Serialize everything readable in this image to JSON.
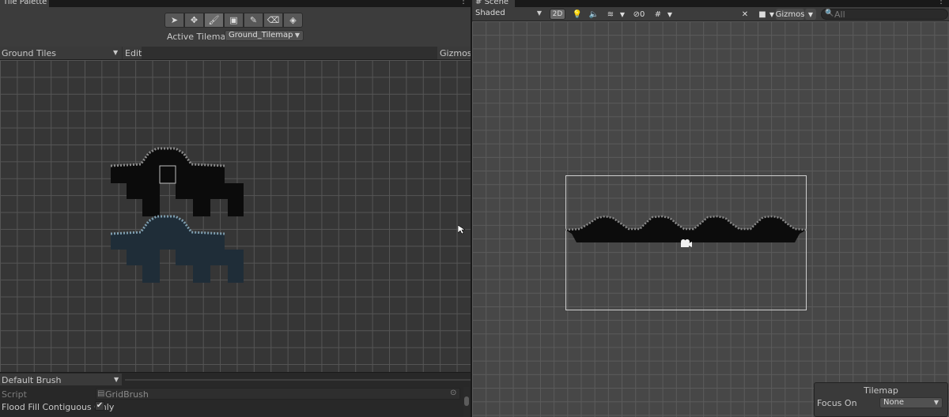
{
  "tile_palette": {
    "tab_title": "Tile Palette",
    "tools": [
      {
        "name": "select-icon",
        "glyph": "➤"
      },
      {
        "name": "move-icon",
        "glyph": "✥"
      },
      {
        "name": "paint-brush-icon",
        "glyph": "🖌"
      },
      {
        "name": "box-fill-icon",
        "glyph": "▣"
      },
      {
        "name": "picker-icon",
        "glyph": "✎"
      },
      {
        "name": "eraser-icon",
        "glyph": "⌫"
      },
      {
        "name": "fill-bucket-icon",
        "glyph": "◈"
      }
    ],
    "active_tilemap_label": "Active Tilemap",
    "active_tilemap_value": "Ground_Tilemap",
    "palette_dropdown": "Ground Tiles",
    "edit_label": "Edit",
    "gizmos_label": "Gizmos",
    "brush_dropdown": "Default Brush",
    "script_label": "Script",
    "script_value": "GridBrush",
    "flood_fill_label": "Flood Fill Contiguous Only",
    "flood_fill_checked": true
  },
  "scene": {
    "tab_title": "Scene",
    "shading_mode": "Shaded",
    "mode_2d": "2D",
    "hidden_count": "0",
    "gizmos_label": "Gizmos",
    "search_placeholder": "All",
    "overlay": {
      "title": "Tilemap",
      "focus_label": "Focus On",
      "focus_value": "None"
    }
  },
  "colors": {
    "panel_bg": "#282828",
    "toolbar_bg": "#3c3c3c",
    "grid_bg": "#363636",
    "scene_bg": "#474747"
  }
}
